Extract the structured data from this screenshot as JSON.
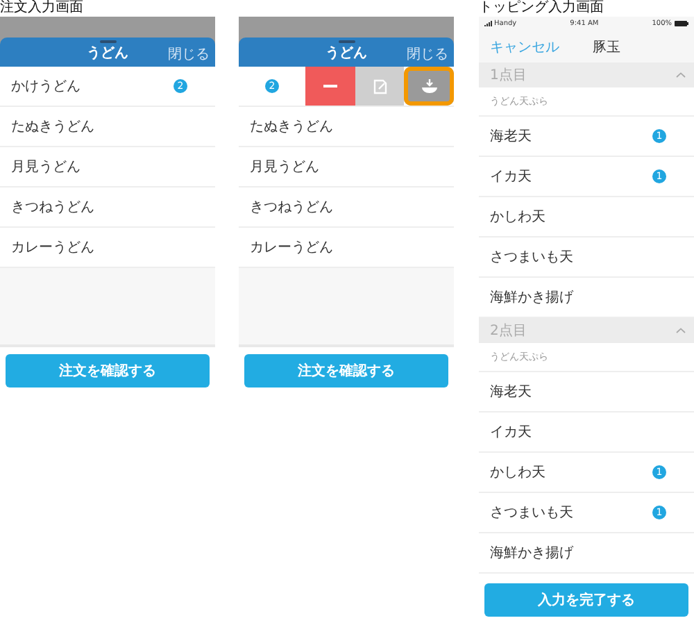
{
  "screens": [
    {
      "kind": "order",
      "title": "注文入力画面",
      "sheet": {
        "title": "うどん",
        "close": "閉じる"
      },
      "items": [
        {
          "name": "かけうどん",
          "count": "2",
          "swiped": false
        },
        {
          "name": "たぬきうどん",
          "swiped": false
        },
        {
          "name": "月見うどん",
          "swiped": false
        },
        {
          "name": "きつねうどん",
          "swiped": false
        },
        {
          "name": "カレーうどん",
          "swiped": false
        }
      ],
      "button": "注文を確認する"
    },
    {
      "kind": "order",
      "sheet": {
        "title": "うどん",
        "close": "閉じる"
      },
      "items": [
        {
          "count": "2",
          "swiped": true,
          "actions": [
            {
              "kind": "remove",
              "highlighted": false
            },
            {
              "kind": "edit",
              "highlighted": false
            },
            {
              "kind": "topping",
              "highlighted": true
            }
          ]
        },
        {
          "name": "たぬきうどん",
          "swiped": false
        },
        {
          "name": "月見うどん",
          "swiped": false
        },
        {
          "name": "きつねうどん",
          "swiped": false
        },
        {
          "name": "カレーうどん",
          "swiped": false
        }
      ],
      "button": "注文を確認する"
    },
    {
      "kind": "topping",
      "title": "トッピング入力画面",
      "status": {
        "carrier": "Handy",
        "time": "9:41 AM",
        "battery": "100%"
      },
      "nav": {
        "cancel": "キャンセル",
        "title": "豚玉"
      },
      "sections": [
        {
          "title": "1点目",
          "expanded": true,
          "group": "うどん天ぷら",
          "items": [
            {
              "name": "海老天",
              "count": "1"
            },
            {
              "name": "イカ天",
              "count": "1"
            },
            {
              "name": "かしわ天"
            },
            {
              "name": "さつまいも天"
            },
            {
              "name": "海鮮かき揚げ"
            }
          ]
        },
        {
          "title": "2点目",
          "expanded": true,
          "group": "うどん天ぷら",
          "items": [
            {
              "name": "海老天"
            },
            {
              "name": "イカ天"
            },
            {
              "name": "かしわ天",
              "count": "1"
            },
            {
              "name": "さつまいも天",
              "count": "1"
            },
            {
              "name": "海鮮かき揚げ"
            }
          ]
        }
      ],
      "button": "入力を完了する"
    }
  ]
}
